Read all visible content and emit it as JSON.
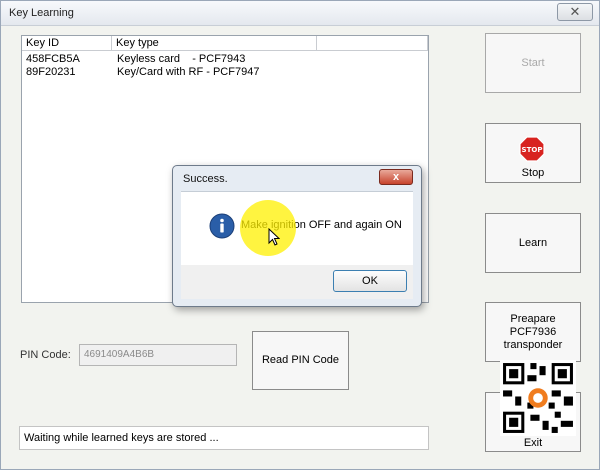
{
  "window": {
    "title": "Key Learning",
    "close_glyph": "✕"
  },
  "list": {
    "columns": [
      "Key ID",
      "Key type"
    ],
    "rows": [
      {
        "id": "458FCB5A",
        "type": "Keyless card    - PCF7943"
      },
      {
        "id": "89F20231",
        "type": "Key/Card with RF - PCF7947"
      }
    ]
  },
  "buttons": {
    "start": "Start",
    "stop": "Stop",
    "stop_sign": "STOP",
    "learn": "Learn",
    "prepare": [
      "Preapare",
      "PCF7936",
      "transponder"
    ],
    "exit": "Exit",
    "read_pin": "Read PIN Code"
  },
  "pin": {
    "label": "PIN Code:",
    "value": "4691409A4B6B"
  },
  "status": "Waiting while learned keys are stored ...",
  "dialog": {
    "title": "Success.",
    "message": "Make ignition OFF and again ON",
    "ok": "OK",
    "close_glyph": "x",
    "icon": "info-icon"
  },
  "colors": {
    "stop_red": "#d8231f",
    "info_blue": "#2a5ea8",
    "highlight_yellow": "#fff000"
  }
}
